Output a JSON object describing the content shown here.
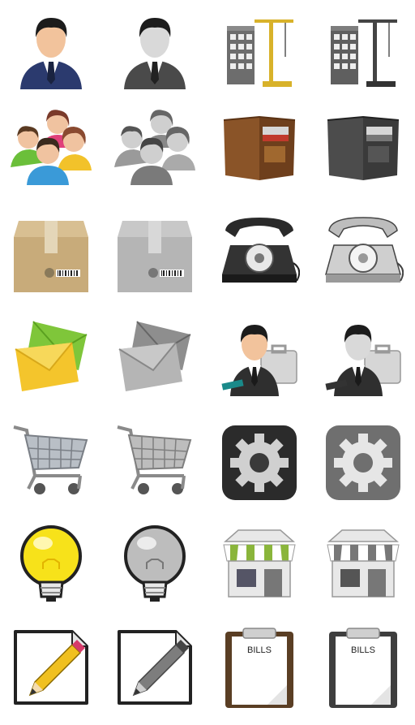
{
  "clipboard": {
    "label": "BILLS"
  },
  "colors": {
    "suit": "#2b3a6e",
    "skin": "#f2c39c",
    "hair": "#1c1c1c",
    "wallet": "#8a5428",
    "box": "#c8ab7a",
    "envelope_yellow": "#f4c52c",
    "envelope_green": "#7fc63a",
    "bulb": "#f7e21a",
    "awning_green": "#8ab53b",
    "pencil": "#f0c020",
    "eraser": "#d63b6a"
  },
  "icons": [
    {
      "name": "business-man-icon",
      "variant": "color"
    },
    {
      "name": "business-man-icon",
      "variant": "gray"
    },
    {
      "name": "construction-crane-building-icon",
      "variant": "color"
    },
    {
      "name": "construction-crane-building-icon",
      "variant": "gray"
    },
    {
      "name": "user-group-icon",
      "variant": "color"
    },
    {
      "name": "user-group-icon",
      "variant": "gray"
    },
    {
      "name": "wallet-icon",
      "variant": "color"
    },
    {
      "name": "wallet-icon",
      "variant": "gray"
    },
    {
      "name": "cardboard-box-icon",
      "variant": "color"
    },
    {
      "name": "cardboard-box-icon",
      "variant": "gray"
    },
    {
      "name": "rotary-telephone-icon",
      "variant": "color"
    },
    {
      "name": "rotary-telephone-icon",
      "variant": "gray"
    },
    {
      "name": "envelopes-icon",
      "variant": "color"
    },
    {
      "name": "envelopes-icon",
      "variant": "gray"
    },
    {
      "name": "businessman-briefcase-icon",
      "variant": "color"
    },
    {
      "name": "businessman-briefcase-icon",
      "variant": "gray"
    },
    {
      "name": "shopping-cart-icon",
      "variant": "color"
    },
    {
      "name": "shopping-cart-icon",
      "variant": "gray"
    },
    {
      "name": "settings-gear-icon",
      "variant": "color"
    },
    {
      "name": "settings-gear-icon",
      "variant": "gray"
    },
    {
      "name": "light-bulb-icon",
      "variant": "color"
    },
    {
      "name": "light-bulb-icon",
      "variant": "gray"
    },
    {
      "name": "shop-store-icon",
      "variant": "color"
    },
    {
      "name": "shop-store-icon",
      "variant": "gray"
    },
    {
      "name": "edit-document-pencil-icon",
      "variant": "color"
    },
    {
      "name": "edit-document-pencil-icon",
      "variant": "gray"
    },
    {
      "name": "clipboard-bills-icon",
      "variant": "color"
    },
    {
      "name": "clipboard-bills-icon",
      "variant": "gray"
    }
  ]
}
